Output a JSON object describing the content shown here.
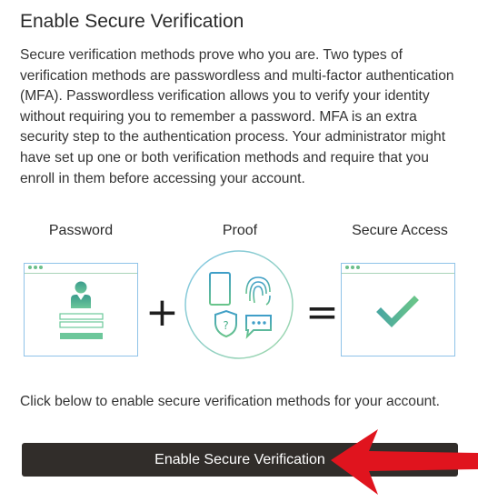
{
  "heading": "Enable Secure Verification",
  "description": "Secure verification methods prove who you are. Two types of verification methods are passwordless and multi-factor authentication (MFA). Passwordless verification allows you to verify your identity without requiring you to remember a password. MFA is an extra security step to the authentication process. Your administrator might have set up one or both verification methods and require that you enroll in them before accessing your account.",
  "illustration": {
    "password_label": "Password",
    "proof_label": "Proof",
    "secure_access_label": "Secure Access",
    "plus_symbol": "+",
    "equals_symbol": "=",
    "icons": [
      "user-icon",
      "phone-icon",
      "fingerprint-icon",
      "shield-question-icon",
      "chat-bubble-icon",
      "checkmark-icon"
    ]
  },
  "instruction": "Click below to enable secure verification methods for your account.",
  "enable_button_label": "Enable Secure Verification",
  "colors": {
    "button_bg": "#312d2a",
    "accent_green": "#5bb88a",
    "accent_teal": "#4aa8a0",
    "window_border": "#8fc3e8",
    "arrow_red": "#e0141e"
  }
}
